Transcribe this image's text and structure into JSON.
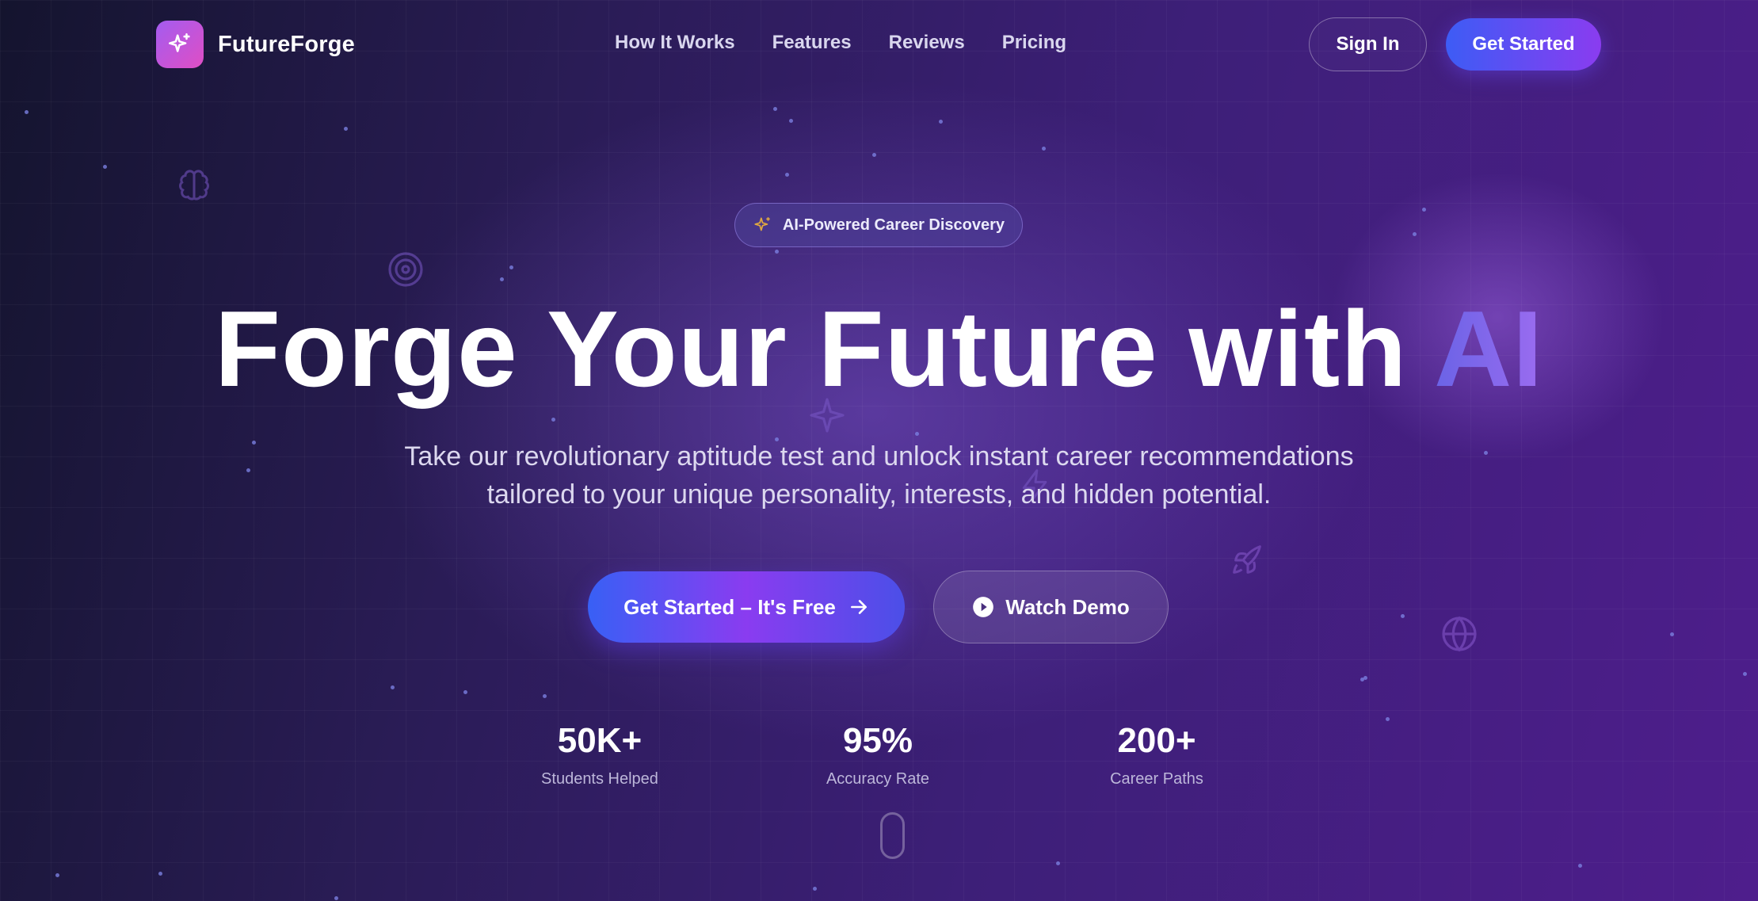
{
  "brand": {
    "name": "FutureForge",
    "icon": "sparkles-icon"
  },
  "nav": {
    "links": [
      "How It Works",
      "Features",
      "Reviews",
      "Pricing"
    ],
    "sign_in": "Sign In",
    "get_started": "Get Started"
  },
  "hero": {
    "badge": "AI-Powered Career Discovery",
    "title_main": "Forge Your Future with ",
    "title_accent": "AI",
    "subtitle_line1": "Take our revolutionary aptitude test and unlock instant career recommendations",
    "subtitle_line2": "tailored to your unique personality, interests, and hidden potential.",
    "cta_primary": "Get Started – It's Free",
    "cta_secondary": "Watch Demo"
  },
  "stats": [
    {
      "value": "50K+",
      "label": "Students Helped"
    },
    {
      "value": "95%",
      "label": "Accuracy Rate"
    },
    {
      "value": "200+",
      "label": "Career Paths"
    }
  ],
  "colors": {
    "accent_blue": "#3d5cf5",
    "accent_purple": "#8a3cf0",
    "logo_gradient_start": "#a35cf0",
    "logo_gradient_end": "#e04ec4"
  }
}
